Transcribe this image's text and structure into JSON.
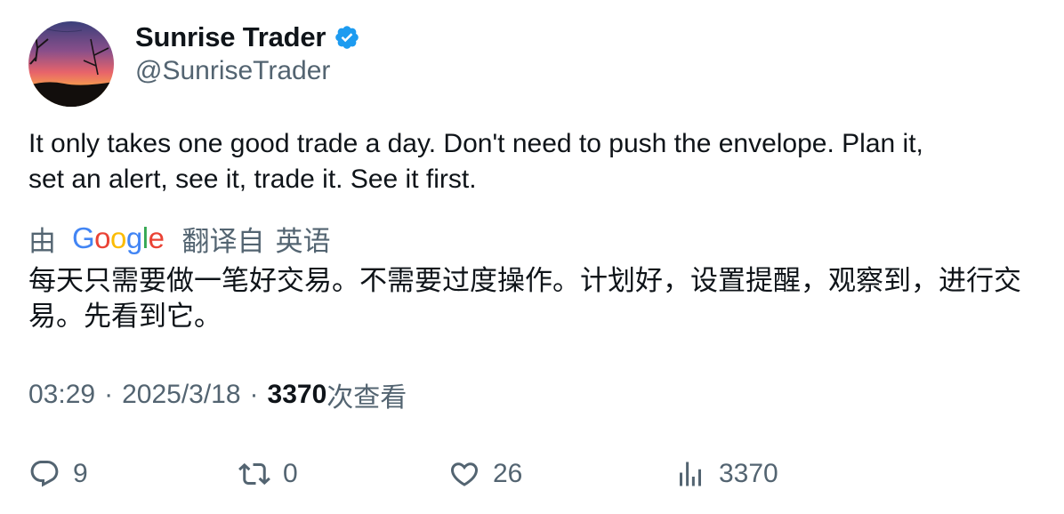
{
  "tweet": {
    "display_name": "Sunrise Trader",
    "handle": "@SunriseTrader",
    "verified": true,
    "text_line1": "It only takes one good trade a day. Don't need to push the envelope.  Plan it,",
    "text_line2": "set an alert, see it, trade it. See it first.",
    "translation": {
      "by_label": "由",
      "provider": "Google",
      "from_label": "翻译自",
      "language": "英语",
      "text": "每天只需要做一笔好交易。不需要过度操作。计划好，设置提醒，观察到，进行交易。先看到它。"
    },
    "meta": {
      "time": "03:29",
      "separator": "·",
      "date": "2025/3/18",
      "views_count": "3370",
      "views_label": "次查看"
    },
    "actions": {
      "reply_count": "9",
      "retweet_count": "0",
      "like_count": "26",
      "views_count": "3370"
    },
    "colors": {
      "text_primary": "#0f1419",
      "text_secondary": "#536471",
      "verified_badge": "#1d9bf0"
    },
    "icons": {
      "verified": "verified-badge-icon",
      "reply": "reply-icon",
      "retweet": "retweet-icon",
      "like": "heart-icon",
      "views": "views-bar-chart-icon"
    }
  }
}
